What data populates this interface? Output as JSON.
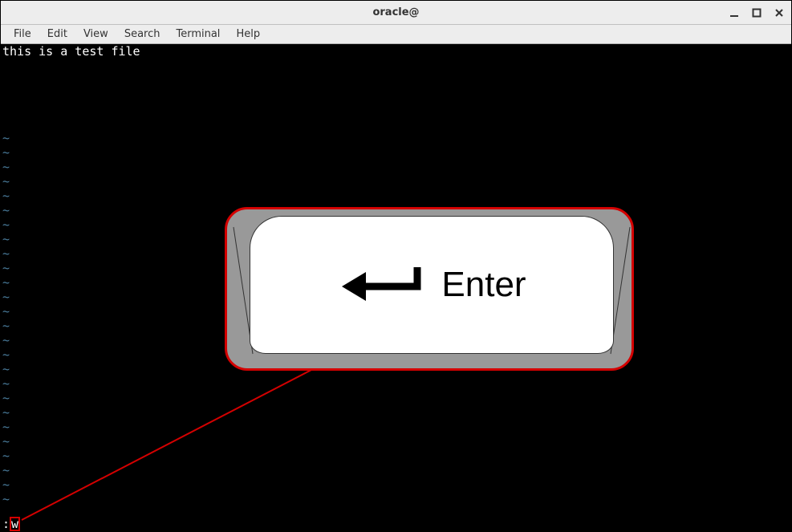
{
  "window": {
    "title": "oracle@"
  },
  "menubar": {
    "items": [
      "File",
      "Edit",
      "View",
      "Search",
      "Terminal",
      "Help"
    ]
  },
  "terminal": {
    "content_line": "this is a test file",
    "tilde": "~",
    "command_prefix": ":",
    "command_char": "w"
  },
  "overlay": {
    "key_label": "Enter"
  }
}
